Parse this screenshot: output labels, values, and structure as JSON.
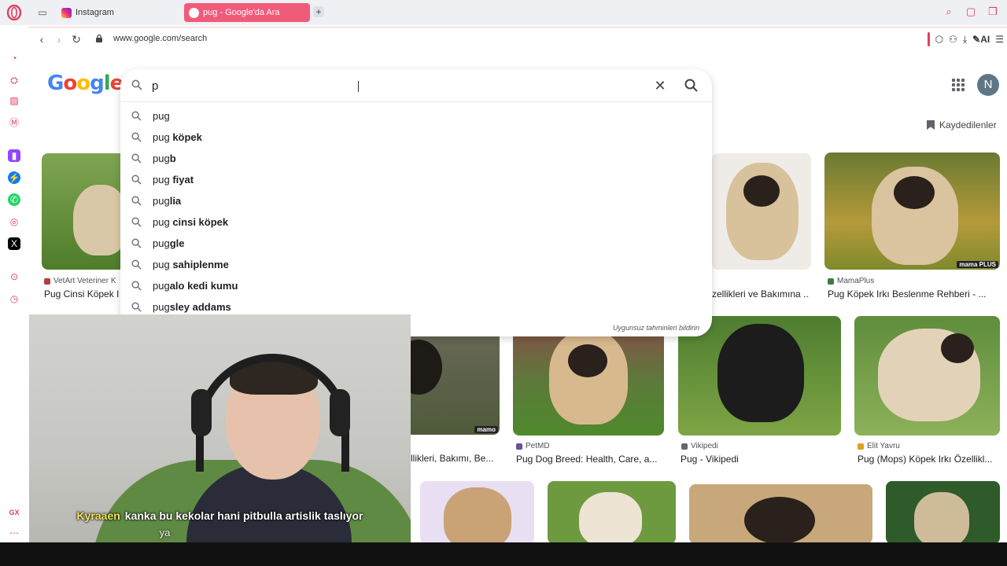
{
  "tabs": {
    "inactive": {
      "label": "Instagram"
    },
    "active": {
      "label": "pug - Google'da Ara"
    }
  },
  "address": {
    "url": "www.google.com/search",
    "ai_label": "AI"
  },
  "google": {
    "logo": "Google",
    "saved_label": "Kaydedilenler",
    "avatar_letter": "N",
    "search_value": "p",
    "report_text": "Uygunsuz tahminleri bildirin",
    "suggestions": [
      {
        "prefix": "pug",
        "rest": ""
      },
      {
        "prefix": "pug ",
        "rest": "köpek"
      },
      {
        "prefix": "pug",
        "rest": "b"
      },
      {
        "prefix": "pug ",
        "rest": "fiyat"
      },
      {
        "prefix": "pug",
        "rest": "lia"
      },
      {
        "prefix": "pug ",
        "rest": "cinsi köpek"
      },
      {
        "prefix": "pug",
        "rest": "gle"
      },
      {
        "prefix": "pug ",
        "rest": "sahiplenme"
      },
      {
        "prefix": "pug",
        "rest": "alo kedi kumu"
      },
      {
        "prefix": "pug",
        "rest": "sley addams"
      }
    ]
  },
  "results": {
    "row1": [
      {
        "source": "VetArt Veteriner K",
        "caption": "Pug Cinsi Köpek I"
      },
      {
        "source": "",
        "caption": "zellikleri ve Bakımına ..."
      },
      {
        "source": "MamaPlus",
        "caption": "Pug Köpek Irkı Beslenme Rehberi - ...",
        "watermark": "mama PLUS"
      }
    ],
    "row2": [
      {
        "source": "",
        "caption": "llikleri, Bakımı, Be...",
        "watermark": "mamo"
      },
      {
        "source": "PetMD",
        "caption": "Pug Dog Breed: Health, Care, a..."
      },
      {
        "source": "Vikipedi",
        "caption": "Pug - Vikipedi"
      },
      {
        "source": "Elit Yavru",
        "caption": "Pug (Mops) Köpek Irkı Özellikl..."
      }
    ]
  },
  "webcam": {
    "username": "Kyraaen",
    "message": "kanka bu kekolar hani pitbulla artislik taslıyor",
    "message_cont": "ya"
  },
  "colors": {
    "accent": "#f15b7a",
    "opera_red": "#e0405e"
  }
}
